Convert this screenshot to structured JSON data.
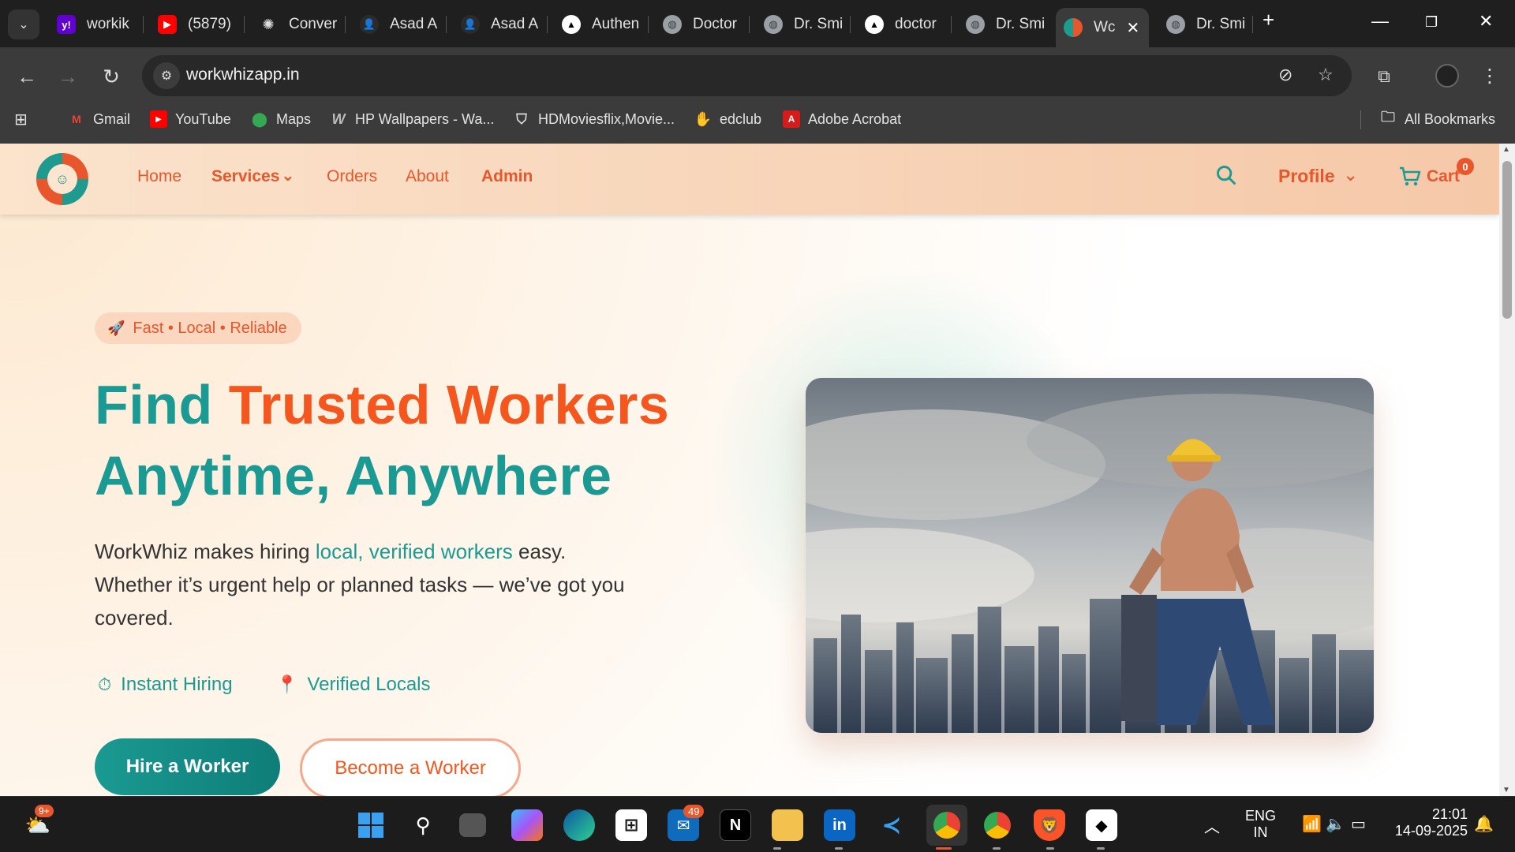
{
  "browser": {
    "tabs": [
      {
        "title": "workik",
        "favicon": "yahoo-icon",
        "color": "#6001d2"
      },
      {
        "title": "(5879)",
        "favicon": "youtube-icon",
        "color": "#ff0000"
      },
      {
        "title": "Conver",
        "favicon": "openai-icon",
        "color": "#444444"
      },
      {
        "title": "Asad A",
        "favicon": "avatar-icon",
        "color": "#2b2b2b"
      },
      {
        "title": "Asad A",
        "favicon": "avatar-icon",
        "color": "#2b2b2b"
      },
      {
        "title": "Authen",
        "favicon": "vercel-icon",
        "color": "#000000"
      },
      {
        "title": "Doctor",
        "favicon": "globe-icon",
        "color": "#5f6368"
      },
      {
        "title": "Dr. Smi",
        "favicon": "globe-icon",
        "color": "#5f6368"
      },
      {
        "title": "doctor",
        "favicon": "vercel-icon",
        "color": "#000000"
      },
      {
        "title": "Dr. Smi",
        "favicon": "globe-icon",
        "color": "#5f6368"
      },
      {
        "title": "Wc",
        "favicon": "workwhiz-icon",
        "color": "#e8562b",
        "active": true
      },
      {
        "title": "Dr. Smi",
        "favicon": "globe-icon",
        "color": "#5f6368"
      }
    ],
    "url": "workwhizapp.in",
    "bookmarks": [
      {
        "label": "Gmail",
        "icon": "gmail-icon"
      },
      {
        "label": "YouTube",
        "icon": "youtube-icon"
      },
      {
        "label": "Maps",
        "icon": "maps-icon"
      },
      {
        "label": "HP Wallpapers - Wa...",
        "icon": "wallpaper-icon"
      },
      {
        "label": "HDMoviesflix,Movie...",
        "icon": "shield-icon"
      },
      {
        "label": "edclub",
        "icon": "edclub-icon"
      },
      {
        "label": "Adobe Acrobat",
        "icon": "acrobat-icon"
      }
    ],
    "all_bookmarks": "All Bookmarks"
  },
  "site": {
    "nav": {
      "home": "Home",
      "services": "Services",
      "orders": "Orders",
      "about": "About",
      "admin": "Admin",
      "profile": "Profile",
      "cart": "Cart",
      "cart_count": "0"
    },
    "hero": {
      "pill": "Fast • Local • Reliable",
      "title_find": "Find",
      "title_trusted": "Trusted Workers",
      "title_line2": "Anytime, Anywhere",
      "desc_pre": "WorkWhiz makes hiring",
      "desc_highlight": "local, verified workers",
      "desc_post": "easy. Whether it’s urgent help or planned tasks — we’ve got you covered.",
      "feature1": "Instant Hiring",
      "feature2": "Verified Locals",
      "btn_hire": "Hire a Worker",
      "btn_become": "Become a Worker"
    },
    "colors": {
      "teal": "#1a9a92",
      "orange": "#f4561d"
    }
  },
  "taskbar": {
    "weather_badge": "9+",
    "mail_badge": "49",
    "lang_line1": "ENG",
    "lang_line2": "IN",
    "time": "21:01",
    "date": "14-09-2025"
  }
}
